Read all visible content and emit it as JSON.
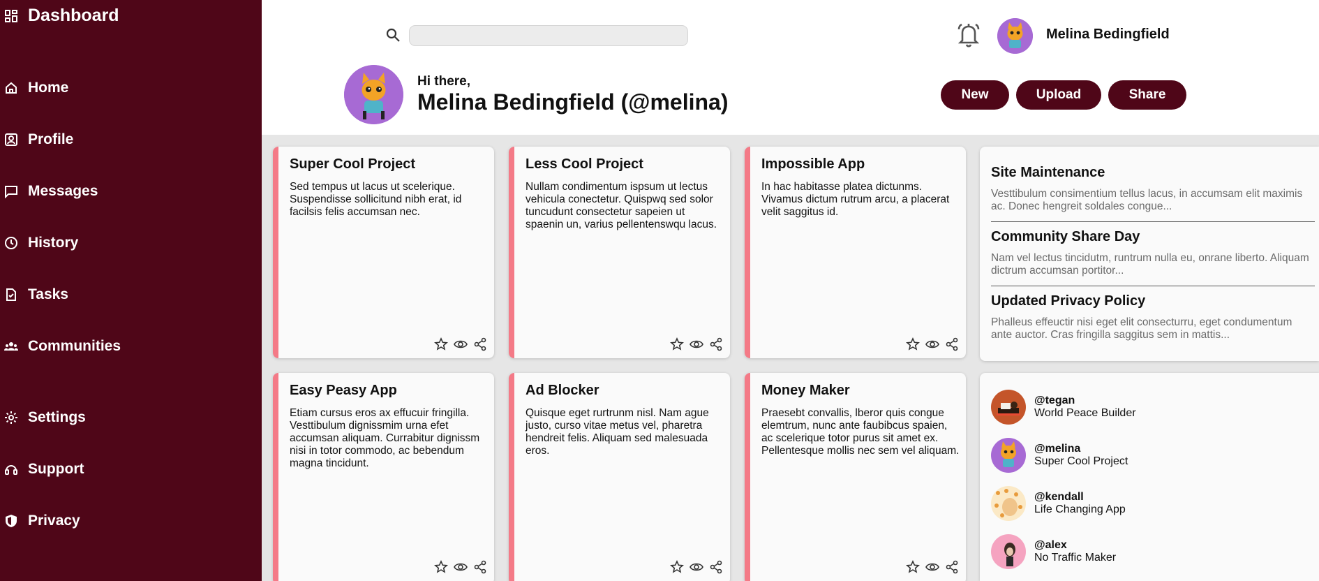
{
  "sidebar": {
    "title": "Dashboard",
    "items": [
      {
        "label": "Home",
        "icon": "home-icon"
      },
      {
        "label": "Profile",
        "icon": "profile-icon"
      },
      {
        "label": "Messages",
        "icon": "message-icon"
      },
      {
        "label": "History",
        "icon": "clock-icon"
      },
      {
        "label": "Tasks",
        "icon": "task-icon"
      },
      {
        "label": "Communities",
        "icon": "community-icon"
      },
      {
        "label": "Settings",
        "icon": "gear-icon"
      },
      {
        "label": "Support",
        "icon": "support-icon"
      },
      {
        "label": "Privacy",
        "icon": "shield-icon"
      }
    ]
  },
  "header": {
    "search_value": "",
    "username": "Melina Bedingfield",
    "greeting": "Hi there,",
    "fullname": "Melina Bedingfield (@melina)",
    "buttons": {
      "new": "New",
      "upload": "Upload",
      "share": "Share"
    }
  },
  "projects": [
    {
      "title": "Super Cool Project",
      "desc": "Sed tempus ut lacus ut scelerique. Suspendisse sollicitund nibh erat, id facilsis felis accumsan nec."
    },
    {
      "title": "Less Cool Project",
      "desc": "Nullam condimentum ispsum ut lectus vehicula conectetur. Quispwq sed solor tuncudunt consectetur sapeien ut spaenin un, varius pellentenswqu lacus."
    },
    {
      "title": "Impossible App",
      "desc": "In hac habitasse platea dictunms. Vivamus dictum rutrum arcu, a placerat velit saggitus id."
    },
    {
      "title": "Easy Peasy App",
      "desc": "Etiam cursus eros ax effucuir fringilla. Vesttibulum dignissmim urna efet accumsan aliquam. Currabitur dignissm nisi in totor commodo, ac bebendum magna tincidunt."
    },
    {
      "title": "Ad Blocker",
      "desc": "Quisque eget rurtrunm nisl. Nam ague justo, curso vitae metus vel, pharetra hendreit felis. Aliquam sed malesuada eros."
    },
    {
      "title": "Money Maker",
      "desc": "Praesebt convallis, lberor quis congue elemtrum, nunc ante faubibcus spaien, ac scelerique totor purus sit amet ex. Pellentesque mollis nec sem vel aliquam."
    }
  ],
  "announcements": [
    {
      "title": "Site Maintenance",
      "text": "Vesttibulum consimentium tellus lacus, in accumsam elit maximis ac. Donec hengreit soldales congue..."
    },
    {
      "title": "Community Share Day",
      "text": "Nam vel lectus tincidutm, runtrum nulla eu, onrane liberto. Aliquam dictrum accumsan portitor..."
    },
    {
      "title": "Updated Privacy Policy",
      "text": "Phalleus effeuctir nisi eget elit consecturru, eget condumentum ante auctor. Cras fringilla saggitus sem in mattis..."
    }
  ],
  "trending": [
    {
      "handle": "@tegan",
      "desc": "World Peace Builder"
    },
    {
      "handle": "@melina",
      "desc": "Super Cool Project"
    },
    {
      "handle": "@kendall",
      "desc": "Life Changing App"
    },
    {
      "handle": "@alex",
      "desc": "No Traffic Maker"
    }
  ],
  "colors": {
    "sidebar": "#4f0618",
    "accent": "#f47a87",
    "avatar": "#a76ad4"
  }
}
